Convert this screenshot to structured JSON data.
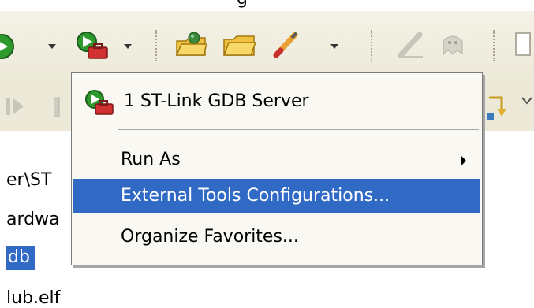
{
  "window": {
    "title_fragment": "g"
  },
  "menu": {
    "items": [
      {
        "label": "1 ST-Link GDB Server",
        "icon": "debug-server-icon"
      },
      {
        "label": "Run As",
        "has_submenu": true
      },
      {
        "label": "External Tools Configurations...",
        "selected": true
      },
      {
        "label": "Organize Favorites..."
      }
    ]
  },
  "editor": {
    "lines": [
      "er\\ST",
      "ardwa",
      "db",
      "lub.elf"
    ]
  },
  "colors": {
    "highlight": "#316ac5",
    "toolbar": "#ece9d8",
    "menu_bg": "#f9f8f3"
  }
}
